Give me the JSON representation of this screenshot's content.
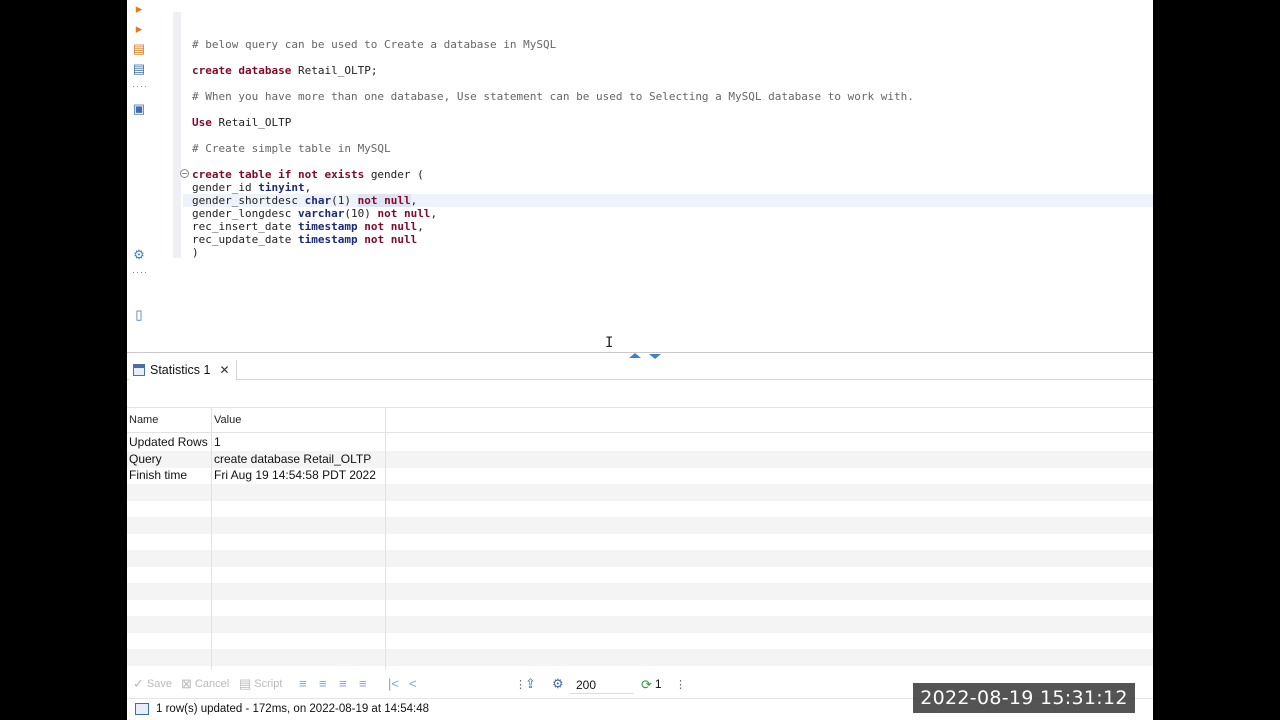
{
  "editor": {
    "lines": [
      {
        "parts": [
          {
            "t": "# below query can be used to Create a database in MySQL",
            "c": "cm"
          }
        ]
      },
      {
        "parts": [
          {
            "t": "create database ",
            "c": "kw"
          },
          {
            "t": "Retail_OLTP;",
            "c": ""
          }
        ]
      },
      {
        "parts": [
          {
            "t": "# When you have more than one database, Use statement can be used to Selecting a MySQL database to work with.",
            "c": "cm"
          }
        ]
      },
      {
        "parts": [
          {
            "t": "Use ",
            "c": "kw"
          },
          {
            "t": "Retail_OLTP",
            "c": ""
          }
        ]
      },
      {
        "parts": [
          {
            "t": "# Create simple table in MySQL",
            "c": "cm"
          }
        ]
      }
    ],
    "table_block": [
      {
        "parts": [
          {
            "t": "create table if not exists ",
            "c": "kw"
          },
          {
            "t": "gender (",
            "c": ""
          }
        ]
      },
      {
        "parts": [
          {
            "t": "gender_id ",
            "c": ""
          },
          {
            "t": "tinyint",
            "c": "ty"
          },
          {
            "t": ",",
            "c": ""
          }
        ]
      },
      {
        "parts": [
          {
            "t": "gender_shortdesc ",
            "c": ""
          },
          {
            "t": "char",
            "c": "ty"
          },
          {
            "t": "(1) ",
            "c": ""
          },
          {
            "t": "not null",
            "c": "kw sel"
          },
          {
            "t": ",",
            "c": ""
          }
        ]
      },
      {
        "parts": [
          {
            "t": "gender_longdesc ",
            "c": ""
          },
          {
            "t": "varchar",
            "c": "ty"
          },
          {
            "t": "(10) ",
            "c": ""
          },
          {
            "t": "not null",
            "c": "kw"
          },
          {
            "t": ",",
            "c": ""
          }
        ]
      },
      {
        "parts": [
          {
            "t": "rec_insert_date ",
            "c": ""
          },
          {
            "t": "timestamp",
            "c": "ty"
          },
          {
            "t": " ",
            "c": ""
          },
          {
            "t": "not null",
            "c": "kw"
          },
          {
            "t": ",",
            "c": ""
          }
        ]
      },
      {
        "parts": [
          {
            "t": "rec_update_date ",
            "c": ""
          },
          {
            "t": "timestamp",
            "c": "ty"
          },
          {
            "t": " ",
            "c": ""
          },
          {
            "t": "not null",
            "c": "kw"
          }
        ]
      },
      {
        "parts": [
          {
            "t": ")",
            "c": ""
          }
        ]
      }
    ]
  },
  "results": {
    "tab_label": "Statistics 1",
    "columns": [
      "Name",
      "Value"
    ],
    "rows": [
      [
        "Updated Rows",
        "1"
      ],
      [
        "Query",
        "create database Retail_OLTP"
      ],
      [
        "Finish time",
        "Fri Aug 19 14:54:58 PDT 2022"
      ]
    ]
  },
  "toolbar": {
    "save_label": "Save",
    "cancel_label": "Cancel",
    "script_label": "Script",
    "fetch_size": "200",
    "refresh_count": "1"
  },
  "status": {
    "text": "1 row(s) updated - 172ms, on 2022-08-19 at 14:54:48"
  },
  "overlay": {
    "timestamp": "2022-08-19  15:31:12"
  },
  "colors": {
    "keyword": "#7f0a2a",
    "type": "#1c2a7a",
    "comment": "#666666",
    "accent": "#3c84c6"
  }
}
